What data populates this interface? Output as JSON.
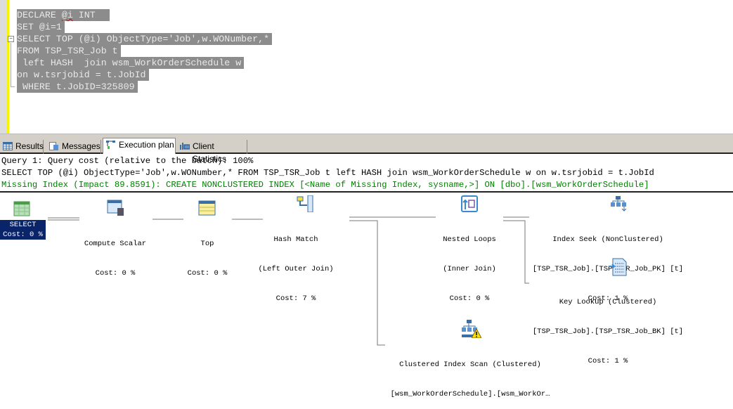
{
  "editor": {
    "lines": [
      "DECLARE @i INT",
      "SET @i=1",
      "SELECT TOP (@i) ObjectType='Job',w.WONumber,*",
      "FROM TSP_TSR_Job t",
      " left HASH  join wsm_WorkOrderSchedule w",
      "on w.tsrjobid = t.JobId",
      " WHERE t.JobID=325809"
    ]
  },
  "tabs": [
    {
      "label": "Results",
      "icon": "grid-icon"
    },
    {
      "label": "Messages",
      "icon": "messages-icon"
    },
    {
      "label": "Execution plan",
      "icon": "execution-plan-icon",
      "active": true
    },
    {
      "label": "Client Statistics",
      "icon": "client-statistics-icon"
    }
  ],
  "plan": {
    "query_header": "Query 1: Query cost (relative to the batch): 100%",
    "query_text": "SELECT TOP (@i) ObjectType='Job',w.WONumber,* FROM TSP_TSR_Job t left HASH join wsm_WorkOrderSchedule w on w.tsrjobid = t.JobId",
    "missing_index": "Missing Index (Impact 89.8591): CREATE NONCLUSTERED INDEX [<Name of Missing Index, sysname,>] ON [dbo].[wsm_WorkOrderSchedule]",
    "missing_index_color": "#008000",
    "nodes": {
      "select": {
        "name": "SELECT",
        "cost": "Cost: 0 %"
      },
      "compute_scalar": {
        "name": "Compute Scalar",
        "cost": "Cost: 0 %"
      },
      "top": {
        "name": "Top",
        "cost": "Cost: 0 %"
      },
      "hash_match": {
        "name": "Hash Match",
        "detail": "(Left Outer Join)",
        "cost": "Cost: 7 %"
      },
      "nested_loops": {
        "name": "Nested Loops",
        "detail": "(Inner Join)",
        "cost": "Cost: 0 %"
      },
      "index_seek": {
        "name": "Index Seek (NonClustered)",
        "detail": "[TSP_TSR_Job].[TSP_TSR_Job_PK] [t]",
        "cost": "Cost: 1 %"
      },
      "key_lookup": {
        "name": "Key Lookup (Clustered)",
        "detail": "[TSP_TSR_Job].[TSP_TSR_Job_BK] [t]",
        "cost": "Cost: 1 %"
      },
      "clustered_scan": {
        "name": "Clustered Index Scan (Clustered)",
        "detail": "[wsm_WorkOrderSchedule].[wsm_WorkOr…"
      }
    }
  }
}
